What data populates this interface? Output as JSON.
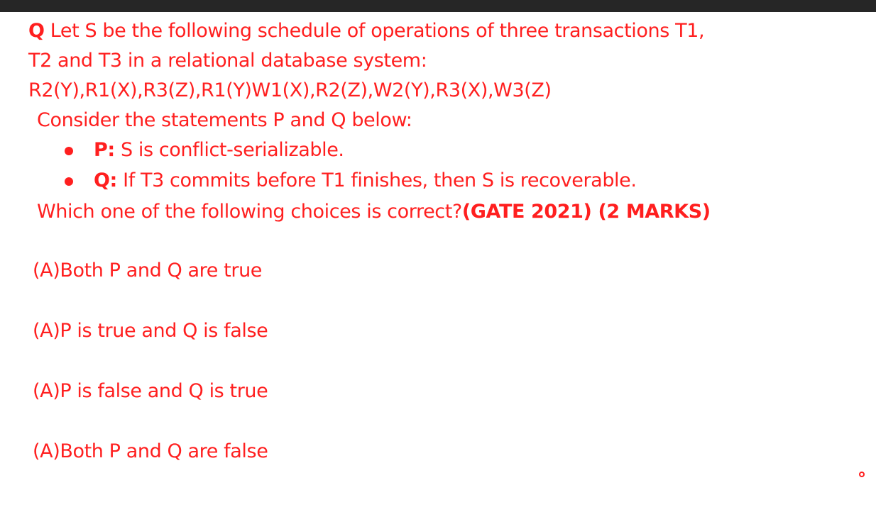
{
  "colors": {
    "accent": "#ff1f1f",
    "top_bar": "#262626",
    "background": "#ffffff"
  },
  "question": {
    "marker": "Q",
    "line1": "Let S be the following schedule of operations of three transactions T1,",
    "line2": "T2 and T3 in a relational database system:",
    "schedule": "R2(Y),R1(X),R3(Z),R1(Y)W1(X),R2(Z),W2(Y),R3(X),W3(Z)",
    "line4": "Consider the statements P and Q below:",
    "statements": [
      {
        "label": "P:",
        "text": "S is conflict-serializable."
      },
      {
        "label": "Q:",
        "text": "If T3 commits before T1 finishes, then S is recoverable."
      }
    ],
    "prompt": "Which one of the following choices is correct?",
    "source": "(GATE 2021) (2 MARKS)"
  },
  "options": [
    "(A)Both P and Q are true",
    "(A)P is true and Q is false",
    "(A)P is false and Q is true",
    "(A)Both P and Q are false"
  ]
}
